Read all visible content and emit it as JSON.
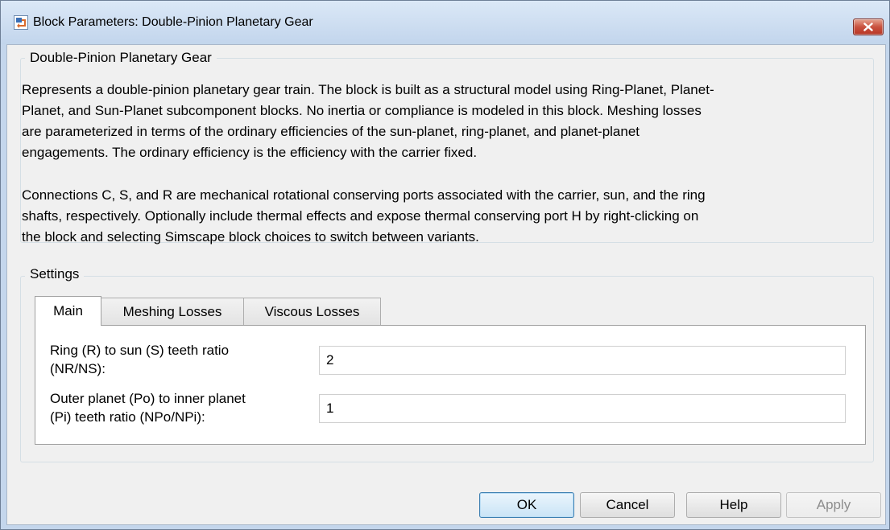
{
  "window": {
    "title": "Block Parameters: Double-Pinion Planetary Gear"
  },
  "description_group": {
    "legend": "Double-Pinion Planetary Gear",
    "paragraph1_lines": [
      "Represents a double-pinion planetary gear train. The block is built as a structural model using Ring-Planet, Planet-",
      "Planet, and Sun-Planet subcomponent blocks. No inertia or compliance is modeled in this block. Meshing losses",
      "are parameterized in terms of the ordinary efficiencies of the sun-planet, ring-planet, and planet-planet",
      "engagements. The ordinary efficiency is the efficiency with the carrier fixed."
    ],
    "paragraph2_lines": [
      "Connections C, S, and R are mechanical rotational conserving ports associated with the carrier, sun, and the ring",
      "shafts, respectively. Optionally include thermal effects and expose thermal conserving port H by right-clicking on",
      "the block and selecting Simscape block choices to switch between variants."
    ]
  },
  "settings": {
    "legend": "Settings",
    "tabs": [
      "Main",
      "Meshing Losses",
      "Viscous Losses"
    ],
    "active_tab": "Main",
    "params": [
      {
        "label_lines": [
          "Ring (R) to sun (S) teeth ratio",
          "(NR/NS):"
        ],
        "value": "2"
      },
      {
        "label_lines": [
          "Outer planet (Po) to inner planet",
          "(Pi) teeth ratio (NPo/NPi):"
        ],
        "value": "1"
      }
    ]
  },
  "buttons": {
    "ok": "OK",
    "cancel": "Cancel",
    "help": "Help",
    "apply": "Apply"
  },
  "colors": {
    "close_button": "#c9523f",
    "default_button_border": "#3c7fb1",
    "title_bar": "#c2d5ec"
  }
}
